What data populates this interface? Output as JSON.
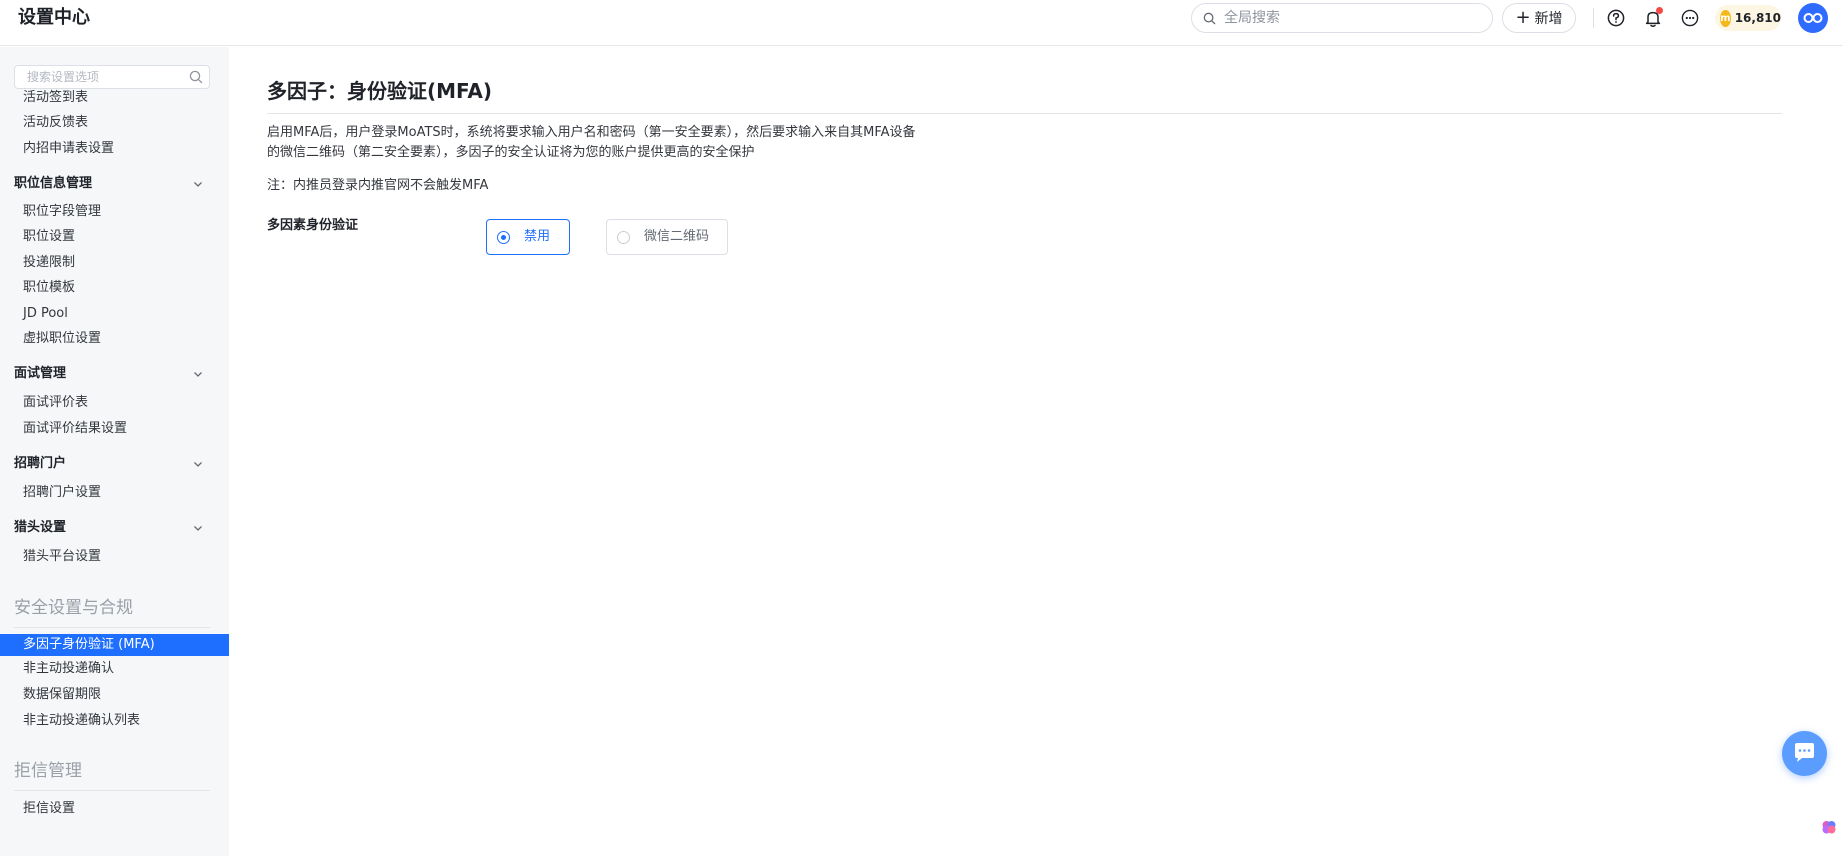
{
  "header": {
    "app_title": "设置中心",
    "search_placeholder": "全局搜索",
    "new_label": "新增",
    "coins": "16,810",
    "coin_symbol": "m"
  },
  "sidebar": {
    "search_placeholder": "搜索设置选项",
    "items_top": [
      "活动签到表",
      "活动反馈表",
      "内招申请表设置"
    ],
    "groups": [
      {
        "title": "职位信息管理",
        "items": [
          "职位字段管理",
          "职位设置",
          "投递限制",
          "职位模板",
          "JD Pool",
          "虚拟职位设置"
        ]
      },
      {
        "title": "面试管理",
        "items": [
          "面试评价表",
          "面试评价结果设置"
        ]
      },
      {
        "title": "招聘门户",
        "items": [
          "招聘门户设置"
        ]
      },
      {
        "title": "猎头设置",
        "items": [
          "猎头平台设置"
        ]
      }
    ],
    "sections": [
      {
        "title": "安全设置与合规",
        "active_item": "多因子身份验证 (MFA)",
        "items": [
          "非主动投递确认",
          "数据保留期限",
          "非主动投递确认列表"
        ]
      },
      {
        "title": "拒信管理",
        "items": [
          "拒信设置"
        ]
      }
    ]
  },
  "main": {
    "title": "多因子：身份验证(MFA)",
    "description": "启用MFA后，用户登录MoATS时，系统将要求输入用户名和密码（第一安全要素），然后要求输入来自其MFA设备的微信二维码（第二安全要素），多因子的安全认证将为您的账户提供更高的安全保护",
    "note": "注：内推员登录内推官网不会触发MFA",
    "field_label": "多因素身份验证",
    "options": [
      {
        "label": "禁用",
        "selected": true
      },
      {
        "label": "微信二维码",
        "selected": false
      }
    ]
  },
  "colors": {
    "accent": "#1e6eff",
    "sidebar_bg": "#f6f7f9",
    "notification_dot": "#f54a45",
    "coin": "#f5b81c"
  },
  "icons": [
    "search-icon",
    "plus-icon",
    "help-icon",
    "bell-icon",
    "more-icon",
    "coin-icon",
    "avatar",
    "chevron-down-icon",
    "chat-icon",
    "brain-icon"
  ]
}
